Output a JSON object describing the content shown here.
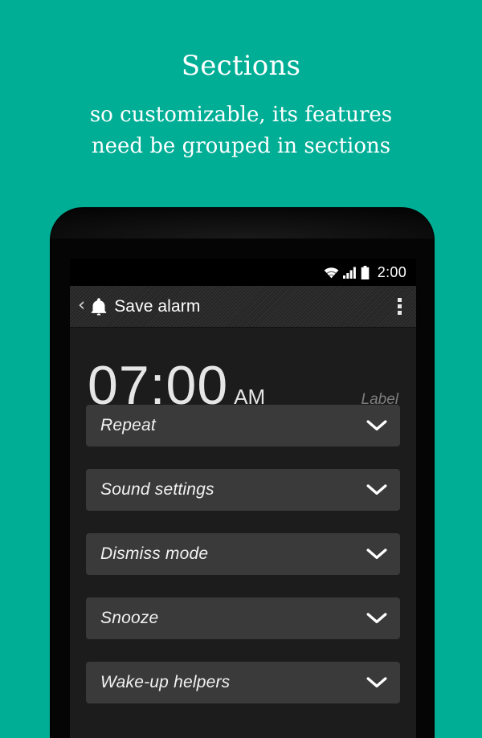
{
  "promo": {
    "title": "Sections",
    "subtitle_line1": "so customizable, its features",
    "subtitle_line2": "need be grouped in sections",
    "background_color": "#00ae96",
    "text_color": "#ffffff"
  },
  "device": {
    "bezel_color": "#050505",
    "screen_background": "#1c1c1c"
  },
  "status_bar": {
    "clock": "2:00",
    "icons": [
      "wifi-icon",
      "signal-icon",
      "battery-icon"
    ],
    "background_color": "#000000"
  },
  "action_bar": {
    "back_icon": "back-chevron-icon",
    "app_icon": "bell-icon",
    "title": "Save alarm",
    "overflow_icon": "overflow-menu-icon",
    "background_color": "#2b2b2b"
  },
  "alarm": {
    "time": "07:00",
    "meridiem": "AM",
    "label": "Label",
    "time_color": "#e6e6e6",
    "label_color": "#7e7e7e"
  },
  "sections": {
    "row_background": "#3a3a3a",
    "expand_icon": "chevron-down-icon",
    "items": [
      {
        "label": "Repeat"
      },
      {
        "label": "Sound settings"
      },
      {
        "label": "Dismiss mode"
      },
      {
        "label": "Snooze"
      },
      {
        "label": "Wake-up helpers"
      }
    ]
  }
}
